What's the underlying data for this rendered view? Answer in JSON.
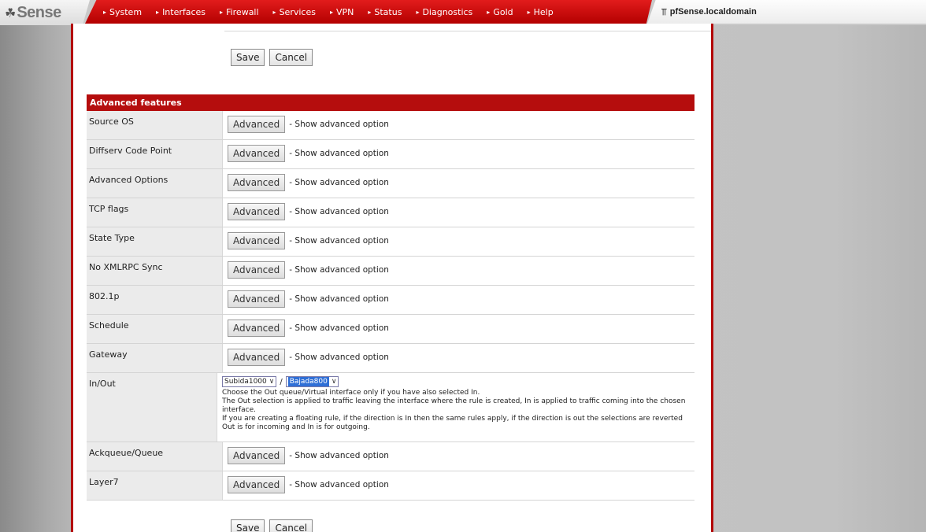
{
  "logo": {
    "icon": "pfsense-logo-icon",
    "text": "Sense"
  },
  "menu": [
    "System",
    "Interfaces",
    "Firewall",
    "Services",
    "VPN",
    "Status",
    "Diagnostics",
    "Gold",
    "Help"
  ],
  "host": {
    "icon": "network-icon",
    "name": "pfSense.localdomain"
  },
  "top_buttons": {
    "save": "Save",
    "cancel": "Cancel"
  },
  "bottom_buttons": {
    "save": "Save",
    "cancel": "Cancel"
  },
  "section": {
    "title": "Advanced features"
  },
  "rows": [
    {
      "label": "Source OS",
      "button": "Advanced",
      "text": "- Show advanced option"
    },
    {
      "label": "Diffserv Code Point",
      "button": "Advanced",
      "text": "- Show advanced option"
    },
    {
      "label": "Advanced Options",
      "button": "Advanced",
      "text": "- Show advanced option"
    },
    {
      "label": "TCP flags",
      "button": "Advanced",
      "text": "- Show advanced option"
    },
    {
      "label": "State Type",
      "button": "Advanced",
      "text": "- Show advanced option"
    },
    {
      "label": "No XMLRPC Sync",
      "button": "Advanced",
      "text": "- Show advanced option"
    },
    {
      "label": "802.1p",
      "button": "Advanced",
      "text": "- Show advanced option"
    },
    {
      "label": "Schedule",
      "button": "Advanced",
      "text": "- Show advanced option"
    },
    {
      "label": "Gateway",
      "button": "Advanced",
      "text": "- Show advanced option"
    }
  ],
  "inout": {
    "label": "In/Out",
    "in_value": "Subida1000",
    "separator": "/",
    "out_value": "Bajada800",
    "help": [
      "Choose the Out queue/Virtual interface only if you have also selected In.",
      "The Out selection is applied to traffic leaving the interface where the rule is created, In is applied to traffic coming into the chosen interface.",
      "If you are creating a floating rule, if the direction is In then the same rules apply, if the direction is out the selections are reverted Out is for incoming and In is for outgoing."
    ]
  },
  "rows_after": [
    {
      "label": "Ackqueue/Queue",
      "button": "Advanced",
      "text": "- Show advanced option"
    },
    {
      "label": "Layer7",
      "button": "Advanced",
      "text": "- Show advanced option"
    }
  ]
}
